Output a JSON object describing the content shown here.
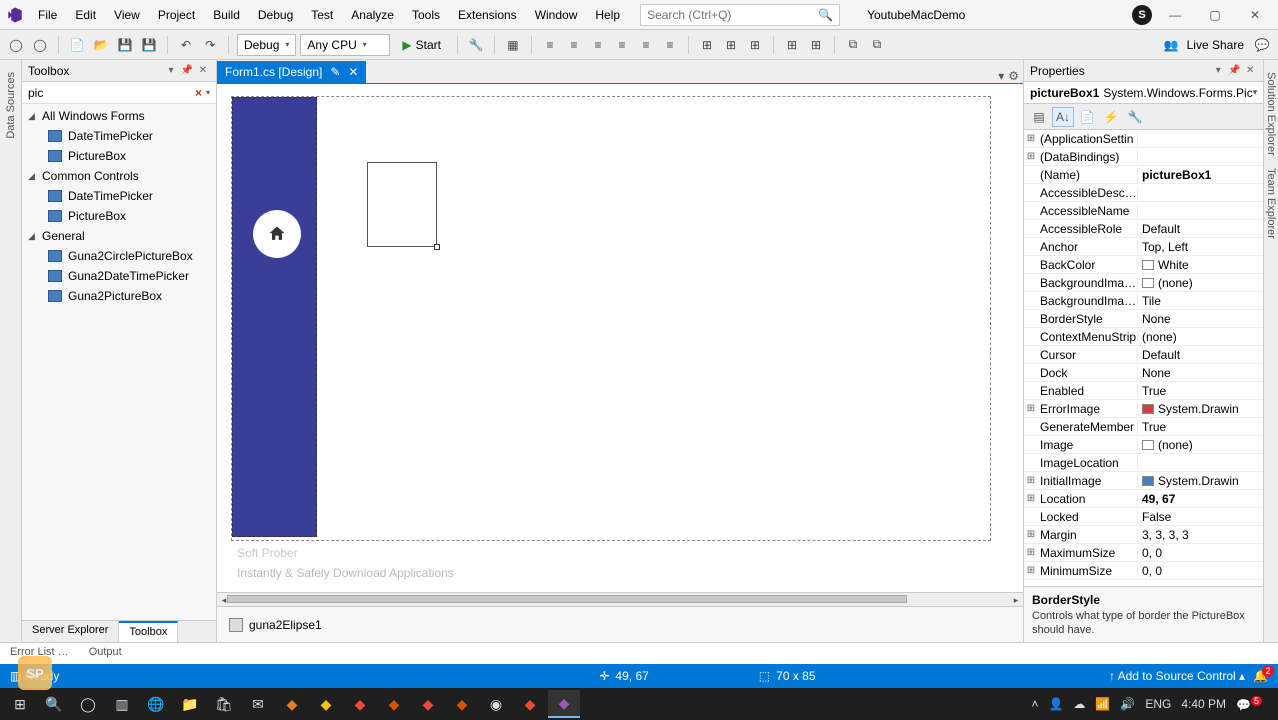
{
  "title_context": "YoutubeMacDemo",
  "menu": [
    "File",
    "Edit",
    "View",
    "Project",
    "Build",
    "Debug",
    "Test",
    "Analyze",
    "Tools",
    "Extensions",
    "Window",
    "Help"
  ],
  "search_placeholder": "Search (Ctrl+Q)",
  "user_initial": "S",
  "toolbar": {
    "config": "Debug",
    "platform": "Any CPU",
    "start": "Start",
    "liveshare": "Live Share"
  },
  "left_vtab": "Data Sources",
  "toolbox": {
    "title": "Toolbox",
    "search_value": "pic",
    "groups": [
      {
        "name": "All Windows Forms",
        "items": [
          "DateTimePicker",
          "PictureBox"
        ]
      },
      {
        "name": "Common Controls",
        "items": [
          "DateTimePicker",
          "PictureBox"
        ]
      },
      {
        "name": "General",
        "items": [
          "Guna2CirclePictureBox",
          "Guna2DateTimePicker",
          "Guna2PictureBox"
        ]
      }
    ],
    "bottom_tabs": [
      "Server Explorer",
      "Toolbox"
    ]
  },
  "doc_tab": {
    "label": "Form1.cs [Design]",
    "dirty": "✎"
  },
  "tray_component": "guna2Elipse1",
  "properties": {
    "panel_title": "Properties",
    "object_name": "pictureBox1",
    "object_type": "System.Windows.Forms.Pic",
    "rows": [
      {
        "exp": "⊞",
        "k": "(ApplicationSettin",
        "v": ""
      },
      {
        "exp": "⊞",
        "k": "(DataBindings)",
        "v": ""
      },
      {
        "exp": "",
        "k": "(Name)",
        "v": "pictureBox1",
        "bold": true
      },
      {
        "exp": "",
        "k": "AccessibleDescript",
        "v": ""
      },
      {
        "exp": "",
        "k": "AccessibleName",
        "v": ""
      },
      {
        "exp": "",
        "k": "AccessibleRole",
        "v": "Default"
      },
      {
        "exp": "",
        "k": "Anchor",
        "v": "Top, Left"
      },
      {
        "exp": "",
        "k": "BackColor",
        "v": "White",
        "swatch": "#ffffff"
      },
      {
        "exp": "",
        "k": "BackgroundImage",
        "v": "(none)",
        "swatch": "#ffffff"
      },
      {
        "exp": "",
        "k": "BackgroundImage",
        "v": "Tile"
      },
      {
        "exp": "",
        "k": "BorderStyle",
        "v": "None"
      },
      {
        "exp": "",
        "k": "ContextMenuStrip",
        "v": "(none)"
      },
      {
        "exp": "",
        "k": "Cursor",
        "v": "Default"
      },
      {
        "exp": "",
        "k": "Dock",
        "v": "None"
      },
      {
        "exp": "",
        "k": "Enabled",
        "v": "True"
      },
      {
        "exp": "⊞",
        "k": "ErrorImage",
        "v": "System.Drawin",
        "swatch": "#d04040"
      },
      {
        "exp": "",
        "k": "GenerateMember",
        "v": "True"
      },
      {
        "exp": "",
        "k": "Image",
        "v": "(none)",
        "swatch": "#ffffff"
      },
      {
        "exp": "",
        "k": "ImageLocation",
        "v": ""
      },
      {
        "exp": "⊞",
        "k": "InitialImage",
        "v": "System.Drawin",
        "swatch": "#4a7dbb"
      },
      {
        "exp": "⊞",
        "k": "Location",
        "v": "49, 67",
        "bold": true
      },
      {
        "exp": "",
        "k": "Locked",
        "v": "False"
      },
      {
        "exp": "⊞",
        "k": "Margin",
        "v": "3, 3, 3, 3"
      },
      {
        "exp": "⊞",
        "k": "MaximumSize",
        "v": "0, 0"
      },
      {
        "exp": "⊞",
        "k": "MinimumSize",
        "v": "0, 0"
      }
    ],
    "help_title": "BorderStyle",
    "help_desc": "Controls what type of border the PictureBox should have."
  },
  "right_vtabs": [
    "Solution Explorer",
    "Team Explorer"
  ],
  "bottom_tool_tabs": [
    "Error List …",
    "Output"
  ],
  "status": {
    "ready": "Ready",
    "pos_icon": "✛",
    "pos": "49, 67",
    "size_icon": "⟶",
    "size": "70 x 85",
    "add_source": "Add to Source Control",
    "notif_count": "2"
  },
  "taskbar": {
    "time": "4:40 PM",
    "notif": "5"
  },
  "watermark": {
    "big": "Soft Prober",
    "sub": "Instantly & Safely Download Applications",
    "badge": "SP"
  }
}
